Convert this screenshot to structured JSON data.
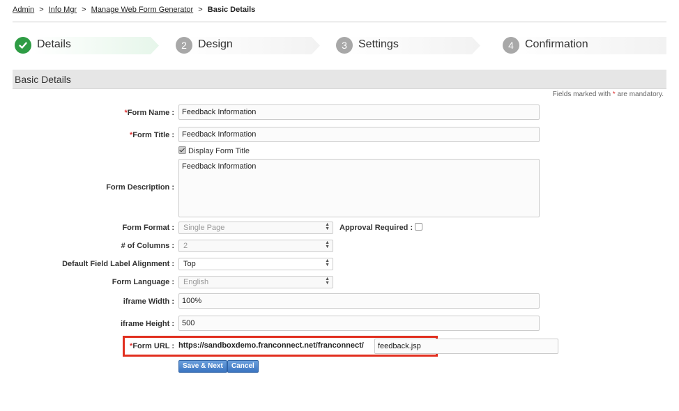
{
  "breadcrumb": {
    "items": [
      "Admin",
      "Info Mgr",
      "Manage Web Form Generator"
    ],
    "current": "Basic Details",
    "separator": ">"
  },
  "steps": [
    {
      "number": "1",
      "label": "Details",
      "status": "complete"
    },
    {
      "number": "2",
      "label": "Design",
      "status": "pending"
    },
    {
      "number": "3",
      "label": "Settings",
      "status": "pending"
    },
    {
      "number": "4",
      "label": "Confirmation",
      "status": "pending"
    }
  ],
  "section": {
    "title": "Basic Details"
  },
  "mandatory_note": {
    "prefix": "Fields marked with ",
    "star": "*",
    "suffix": " are mandatory."
  },
  "form": {
    "required_marker": "*",
    "form_name": {
      "label": "Form Name :",
      "value": "Feedback Information"
    },
    "form_title": {
      "label": "Form Title :",
      "value": "Feedback Information"
    },
    "display_form_title": {
      "label": "Display Form Title",
      "checked": true
    },
    "form_description": {
      "label": "Form Description :",
      "value": "Feedback Information"
    },
    "form_format": {
      "label": "Form Format :",
      "value": "Single Page"
    },
    "approval_required": {
      "label": "Approval Required :",
      "checked": false
    },
    "num_columns": {
      "label": "# of Columns :",
      "value": "2"
    },
    "label_alignment": {
      "label": "Default Field Label Alignment :",
      "value": "Top"
    },
    "form_language": {
      "label": "Form Language :",
      "value": "English"
    },
    "iframe_width": {
      "label": "iframe Width :",
      "value": "100%"
    },
    "iframe_height": {
      "label": "iframe Height :",
      "value": "500"
    },
    "form_url": {
      "label": "Form URL :",
      "prefix": "https://sandboxdemo.franconnect.net/franconnect/",
      "value": "feedback.jsp"
    }
  },
  "buttons": {
    "save_next": "Save & Next",
    "cancel": "Cancel"
  },
  "colors": {
    "step_active": "#2e9c44",
    "step_inactive": "#a8a8a8",
    "button": "#3a74c0",
    "highlight": "#e12f1f",
    "required": "#d33333"
  }
}
